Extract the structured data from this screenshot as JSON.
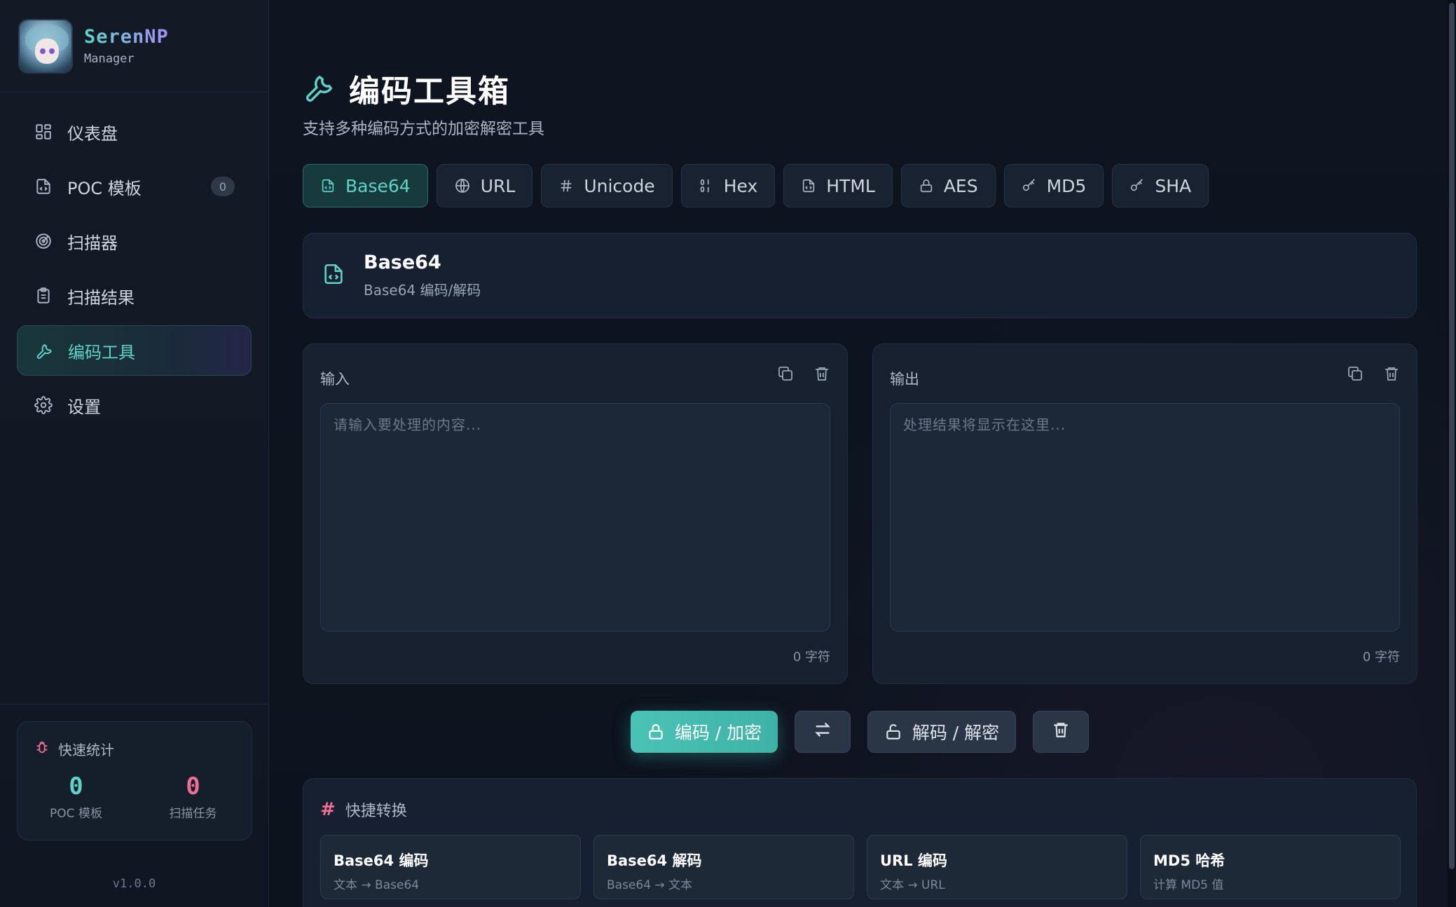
{
  "brand": {
    "name": "SerenNP",
    "subtitle": "Manager"
  },
  "nav": [
    {
      "label": "仪表盘",
      "icon": "dashboard-icon"
    },
    {
      "label": "POC 模板",
      "icon": "file-code-icon",
      "badge": "0"
    },
    {
      "label": "扫描器",
      "icon": "radar-icon"
    },
    {
      "label": "扫描结果",
      "icon": "clipboard-icon"
    },
    {
      "label": "编码工具",
      "icon": "wrench-icon",
      "active": true
    },
    {
      "label": "设置",
      "icon": "gear-icon"
    }
  ],
  "stats": {
    "title": "快速统计",
    "poc_count": "0",
    "poc_label": "POC 模板",
    "task_count": "0",
    "task_label": "扫描任务"
  },
  "version": "v1.0.0",
  "page": {
    "title": "编码工具箱",
    "subtitle": "支持多种编码方式的加密解密工具"
  },
  "tabs": [
    {
      "label": "Base64",
      "icon": "file-code-icon",
      "active": true
    },
    {
      "label": "URL",
      "icon": "globe-icon"
    },
    {
      "label": "Unicode",
      "icon": "hash-icon"
    },
    {
      "label": "Hex",
      "icon": "binary-icon"
    },
    {
      "label": "HTML",
      "icon": "file-code-icon"
    },
    {
      "label": "AES",
      "icon": "lock-icon"
    },
    {
      "label": "MD5",
      "icon": "key-icon"
    },
    {
      "label": "SHA",
      "icon": "key-icon"
    }
  ],
  "info": {
    "title": "Base64",
    "description": "Base64 编码/解码"
  },
  "input_panel": {
    "label": "输入",
    "placeholder": "请输入要处理的内容...",
    "count": "0 字符"
  },
  "output_panel": {
    "label": "输出",
    "placeholder": "处理结果将显示在这里...",
    "count": "0 字符"
  },
  "buttons": {
    "encode": "编码 / 加密",
    "decode": "解码 / 解密"
  },
  "quick": {
    "title": "快捷转换",
    "items": [
      {
        "title": "Base64 编码",
        "desc": "文本 → Base64"
      },
      {
        "title": "Base64 解码",
        "desc": "Base64 → 文本"
      },
      {
        "title": "URL 编码",
        "desc": "文本 → URL"
      },
      {
        "title": "MD5 哈希",
        "desc": "计算 MD5 值"
      }
    ]
  },
  "colors": {
    "accent": "#5fd3c6",
    "pink": "#f06e96",
    "bg": "#0d121b"
  }
}
